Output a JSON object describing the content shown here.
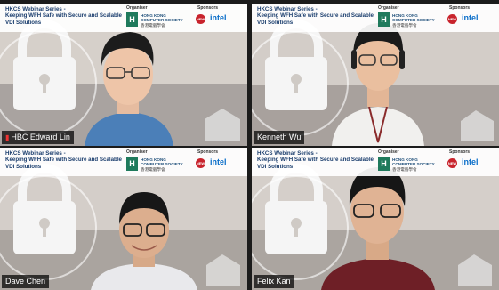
{
  "banner": {
    "title_line1": "HKCS Webinar Series -",
    "title_line2": "Keeping WFH Safe with Secure and Scalable",
    "title_line3": "VDI Solutions",
    "organiser_label": "Organiser",
    "sponsors_label": "Sponsors",
    "org_line1": "HONG KONG",
    "org_line2": "COMPUTER SOCIETY",
    "org_line3": "香港電腦學會",
    "sponsor2": "intel"
  },
  "participants": [
    {
      "name": "HBC Edward Lin",
      "muted": true,
      "active": true
    },
    {
      "name": "Kenneth Wu",
      "muted": false,
      "active": false
    },
    {
      "name": "Dave Chen",
      "muted": false,
      "active": false
    },
    {
      "name": "Felix Kan",
      "muted": false,
      "active": false
    }
  ],
  "colors": {
    "banner_title": "#1a3d6d",
    "active_border": "#f2c230",
    "mic_muted": "#e33333"
  }
}
